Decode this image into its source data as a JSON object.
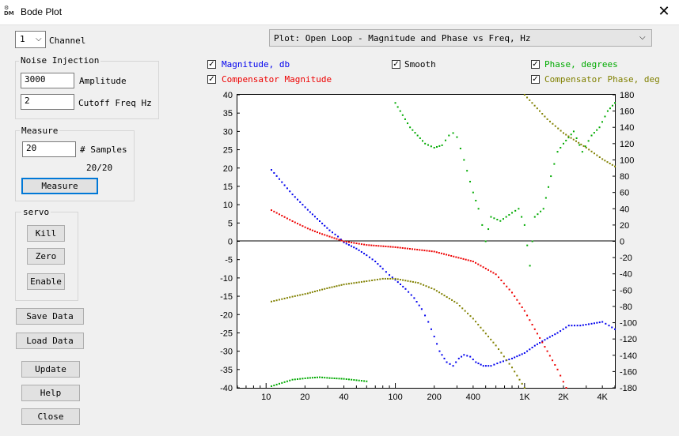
{
  "window": {
    "title": "Bode Plot",
    "icon": "dm-app-icon",
    "close_glyph": "✕"
  },
  "channel": {
    "value": "1",
    "label": "Channel"
  },
  "noise_injection": {
    "title": "Noise Injection",
    "amplitude_value": "3000",
    "amplitude_label": "Amplitude",
    "cutoff_value": "2",
    "cutoff_label": "Cutoff Freq Hz"
  },
  "measure": {
    "title": "Measure",
    "samples_value": "20",
    "samples_label": "# Samples",
    "progress": "20/20",
    "button": "Measure"
  },
  "servo": {
    "title": "servo",
    "kill": "Kill",
    "zero": "Zero",
    "enable": "Enable"
  },
  "buttons": {
    "save": "Save Data",
    "load": "Load Data",
    "update": "Update",
    "help": "Help",
    "close": "Close"
  },
  "plot_select": {
    "value": "Plot: Open Loop - Magnitude and Phase vs Freq, Hz"
  },
  "checkboxes": {
    "magnitude": {
      "label": "Magnitude, db",
      "checked": true,
      "color": "#0000ee"
    },
    "comp_magnitude": {
      "label": "Compensator Magnitude",
      "checked": true,
      "color": "#ee0000"
    },
    "smooth": {
      "label": "Smooth",
      "checked": true,
      "color": "#000000"
    },
    "phase": {
      "label": "Phase, degrees",
      "checked": true,
      "color": "#00aa00"
    },
    "comp_phase": {
      "label": "Compensator Phase, deg",
      "checked": true,
      "color": "#808000"
    }
  },
  "chart_data": {
    "type": "scatter",
    "x_scale": "log",
    "xlim": [
      6,
      5000
    ],
    "ylim_left": [
      -40,
      40
    ],
    "ylim_right": [
      -180,
      180
    ],
    "x_ticks": [
      10,
      20,
      40,
      100,
      200,
      400,
      1000,
      2000,
      4000
    ],
    "x_tick_labels": [
      "10",
      "20",
      "40",
      "100",
      "200",
      "400",
      "1K",
      "2K",
      "4K"
    ],
    "y_left_ticks": [
      40,
      35,
      30,
      25,
      20,
      15,
      10,
      5,
      0,
      -5,
      -10,
      -15,
      -20,
      -25,
      -30,
      -35,
      -40
    ],
    "y_right_ticks": [
      180,
      160,
      140,
      120,
      100,
      80,
      60,
      40,
      20,
      0,
      -20,
      -40,
      -60,
      -80,
      -100,
      -120,
      -140,
      -160,
      -180
    ],
    "series": [
      {
        "name": "Magnitude, db",
        "axis": "left",
        "color": "#0000ee",
        "points": [
          [
            11,
            19.5
          ],
          [
            16,
            12.8
          ],
          [
            21,
            8.6
          ],
          [
            26,
            5.5
          ],
          [
            31,
            3
          ],
          [
            36,
            1.3
          ],
          [
            40,
            -0.3
          ],
          [
            50,
            -2
          ],
          [
            60,
            -3.8
          ],
          [
            70,
            -5.5
          ],
          [
            80,
            -7.5
          ],
          [
            90,
            -9.2
          ],
          [
            100,
            -10.5
          ],
          [
            120,
            -13
          ],
          [
            140,
            -15.5
          ],
          [
            160,
            -18.5
          ],
          [
            180,
            -22
          ],
          [
            200,
            -26
          ],
          [
            220,
            -30
          ],
          [
            250,
            -33
          ],
          [
            280,
            -34
          ],
          [
            310,
            -32
          ],
          [
            340,
            -31
          ],
          [
            380,
            -31.5
          ],
          [
            420,
            -33
          ],
          [
            480,
            -34
          ],
          [
            550,
            -34
          ],
          [
            650,
            -33
          ],
          [
            800,
            -32
          ],
          [
            1000,
            -30.5
          ],
          [
            1200,
            -28.5
          ],
          [
            1500,
            -26.5
          ],
          [
            1800,
            -25
          ],
          [
            2200,
            -23
          ],
          [
            2700,
            -23
          ],
          [
            3300,
            -22.5
          ],
          [
            4000,
            -22
          ],
          [
            4500,
            -23
          ],
          [
            5000,
            -24
          ]
        ]
      },
      {
        "name": "Compensator Magnitude",
        "axis": "left",
        "color": "#ee0000",
        "points": [
          [
            11,
            8.5
          ],
          [
            16,
            5.5
          ],
          [
            21,
            3.5
          ],
          [
            26,
            2.2
          ],
          [
            31,
            1.3
          ],
          [
            40,
            0
          ],
          [
            60,
            -1
          ],
          [
            100,
            -1.6
          ],
          [
            200,
            -2.8
          ],
          [
            400,
            -5.5
          ],
          [
            600,
            -9
          ],
          [
            800,
            -14
          ],
          [
            1000,
            -19
          ],
          [
            1200,
            -24
          ],
          [
            1500,
            -30
          ],
          [
            1800,
            -35
          ],
          [
            2100,
            -40
          ]
        ]
      },
      {
        "name": "Phase, degrees",
        "axis": "right",
        "color": "#00aa00",
        "points": [
          [
            11,
            -178
          ],
          [
            16,
            -170
          ],
          [
            21,
            -168
          ],
          [
            26,
            -167
          ],
          [
            31,
            -168
          ],
          [
            40,
            -169
          ],
          [
            60,
            -172
          ],
          [
            100,
            170
          ],
          [
            130,
            140
          ],
          [
            170,
            120
          ],
          [
            200,
            115
          ],
          [
            230,
            118
          ],
          [
            260,
            130
          ],
          [
            280,
            133
          ],
          [
            300,
            128
          ],
          [
            340,
            100
          ],
          [
            400,
            60
          ],
          [
            440,
            40
          ],
          [
            470,
            20
          ],
          [
            500,
            0
          ],
          [
            550,
            30
          ],
          [
            650,
            25
          ],
          [
            800,
            35
          ],
          [
            900,
            40
          ],
          [
            1000,
            20
          ],
          [
            1100,
            -30
          ],
          [
            1200,
            30
          ],
          [
            1400,
            40
          ],
          [
            1600,
            80
          ],
          [
            1800,
            110
          ],
          [
            2000,
            120
          ],
          [
            2400,
            135
          ],
          [
            2800,
            110
          ],
          [
            3300,
            130
          ],
          [
            3800,
            140
          ],
          [
            4400,
            160
          ],
          [
            5000,
            170
          ]
        ]
      },
      {
        "name": "Compensator Phase, deg",
        "axis": "right",
        "color": "#808000",
        "points": [
          [
            11,
            -74
          ],
          [
            16,
            -68
          ],
          [
            21,
            -64
          ],
          [
            26,
            -60
          ],
          [
            31,
            -57
          ],
          [
            40,
            -53
          ],
          [
            60,
            -49
          ],
          [
            80,
            -46
          ],
          [
            100,
            -46
          ],
          [
            150,
            -51
          ],
          [
            200,
            -59
          ],
          [
            300,
            -76
          ],
          [
            400,
            -95
          ],
          [
            600,
            -128
          ],
          [
            800,
            -155
          ],
          [
            1000,
            -180
          ],
          [
            1000,
            180
          ],
          [
            1500,
            150
          ],
          [
            2000,
            133
          ],
          [
            3000,
            115
          ],
          [
            4000,
            101
          ],
          [
            5000,
            92
          ]
        ]
      }
    ]
  }
}
